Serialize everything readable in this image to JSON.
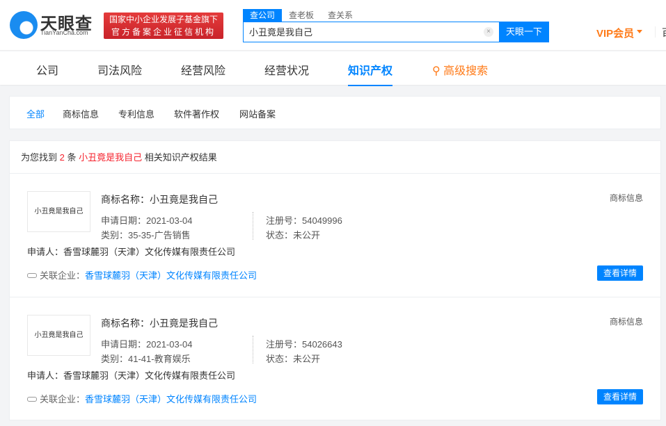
{
  "header": {
    "logo_text": "天眼查",
    "logo_sub": "TianYanCha.com",
    "banner_line1": "国家中小企业发展子基金旗下",
    "banner_line2": "官方备案企业征信机构",
    "search_tabs": [
      "查公司",
      "查老板",
      "查关系"
    ],
    "search_value": "小丑竟是我自己",
    "clear": "×",
    "search_button": "天眼一下",
    "vip": "VIP会员",
    "cut_text": "百"
  },
  "nav": {
    "tabs": [
      "公司",
      "司法风险",
      "经营风险",
      "经营状况",
      "知识产权"
    ],
    "advanced": "高级搜索"
  },
  "filters": [
    "全部",
    "商标信息",
    "专利信息",
    "软件著作权",
    "网站备案"
  ],
  "results": {
    "prefix": "为您找到",
    "count": "2",
    "mid": "条",
    "keyword": "小丑竟是我自己",
    "suffix": "相关知识产权结果",
    "items": [
      {
        "thumb": "小丑竟是我自己",
        "name": "商标名称：小丑竟是我自己",
        "date": "申请日期：2021-03-04",
        "category": "类别：35-35-广告销售",
        "reg": "注册号：54049996",
        "status": "状态：未公开",
        "applicant": "申请人：香雪球麓羽（天津）文化传媒有限责任公司",
        "rel_label": "关联企业：",
        "rel_company": "香雪球麓羽（天津）文化传媒有限责任公司",
        "type": "商标信息",
        "button": "查看详情"
      },
      {
        "thumb": "小丑竟是我自己",
        "name": "商标名称：小丑竟是我自己",
        "date": "申请日期：2021-03-04",
        "category": "类别：41-41-教育娱乐",
        "reg": "注册号：54026643",
        "status": "状态：未公开",
        "applicant": "申请人：香雪球麓羽（天津）文化传媒有限责任公司",
        "rel_label": "关联企业：",
        "rel_company": "香雪球麓羽（天津）文化传媒有限责任公司",
        "type": "商标信息",
        "button": "查看详情"
      }
    ]
  }
}
